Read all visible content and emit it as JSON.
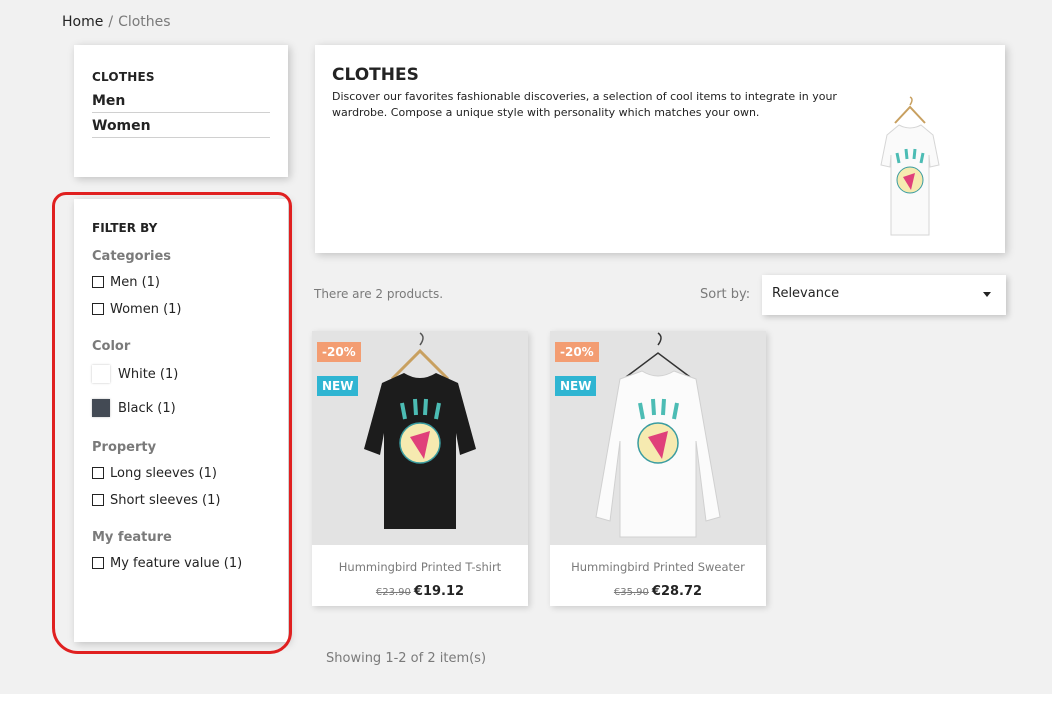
{
  "breadcrumb": {
    "home": "Home",
    "separator": "/",
    "current": "Clothes"
  },
  "category_tree": {
    "title": "CLOTHES",
    "links": [
      "Men",
      "Women"
    ]
  },
  "filters": {
    "title": "FILTER BY",
    "categories": {
      "title": "Categories",
      "options": [
        "Men (1)",
        "Women (1)"
      ]
    },
    "color": {
      "title": "Color",
      "options": [
        {
          "label": "White (1)",
          "swatch": "#ffffff"
        },
        {
          "label": "Black (1)",
          "swatch": "#434a54"
        }
      ]
    },
    "property": {
      "title": "Property",
      "options": [
        "Long sleeves (1)",
        "Short sleeves (1)"
      ]
    },
    "feature": {
      "title": "My feature",
      "options": [
        "My feature value (1)"
      ]
    }
  },
  "header": {
    "title": "CLOTHES",
    "description": "Discover our favorites fashionable discoveries, a selection of cool items to integrate in your wardrobe. Compose a unique style with personality which matches your own."
  },
  "listing": {
    "count_text": "There are 2 products.",
    "sort_label": "Sort by:",
    "sort_value": "Relevance",
    "pagination_text": "Showing 1-2 of 2 item(s)"
  },
  "products": [
    {
      "name": "Hummingbird Printed T-shirt",
      "old_price": "€23.90",
      "price": "€19.12",
      "discount": "-20%",
      "flag": "NEW"
    },
    {
      "name": "Hummingbird Printed Sweater",
      "old_price": "€35.90",
      "price": "€28.72",
      "discount": "-20%",
      "flag": "NEW"
    }
  ],
  "colors": {
    "discount_flag": "#f39d72",
    "new_flag": "#2fb5d2",
    "highlight_outline": "#e02020"
  }
}
